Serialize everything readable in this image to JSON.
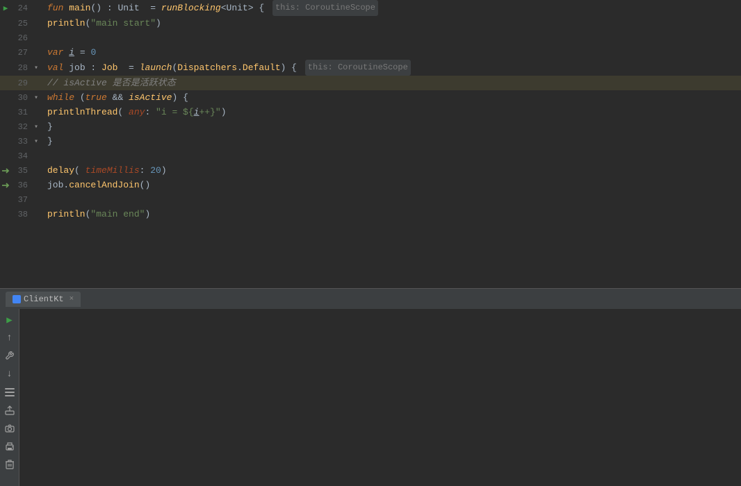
{
  "lines": [
    {
      "num": "24",
      "gutter": "play",
      "fold": "",
      "indent": "",
      "tokens": [
        {
          "t": "kw",
          "v": "fun "
        },
        {
          "t": "fn",
          "v": "main"
        },
        {
          "t": "op",
          "v": "() : "
        },
        {
          "t": "type",
          "v": "Unit"
        },
        {
          "t": "op",
          "v": "  = "
        },
        {
          "t": "fn-italic",
          "v": "runBlocking"
        },
        {
          "t": "op",
          "v": "<Unit> { "
        },
        {
          "t": "hint",
          "v": "this: CoroutineScope"
        }
      ]
    },
    {
      "num": "25",
      "gutter": "",
      "fold": "",
      "indent": "    ",
      "tokens": [
        {
          "t": "fn",
          "v": "println"
        },
        {
          "t": "op",
          "v": "("
        },
        {
          "t": "str",
          "v": "\"main start\""
        },
        {
          "t": "op",
          "v": ")"
        }
      ]
    },
    {
      "num": "26",
      "gutter": "",
      "fold": "",
      "indent": "",
      "tokens": []
    },
    {
      "num": "27",
      "gutter": "",
      "fold": "",
      "indent": "    ",
      "tokens": [
        {
          "t": "kw",
          "v": "var "
        },
        {
          "t": "var-italic",
          "v": "i"
        },
        {
          "t": "op",
          "v": " = "
        },
        {
          "t": "num",
          "v": "0"
        }
      ]
    },
    {
      "num": "28",
      "gutter": "",
      "fold": "fold",
      "indent": "    ",
      "tokens": [
        {
          "t": "kw",
          "v": "val "
        },
        {
          "t": "var-name",
          "v": "job"
        },
        {
          "t": "op",
          "v": " : "
        },
        {
          "t": "type-name",
          "v": "Job"
        },
        {
          "t": "op",
          "v": "  = "
        },
        {
          "t": "fn-italic",
          "v": "launch"
        },
        {
          "t": "op",
          "v": "("
        },
        {
          "t": "type-name",
          "v": "Dispatchers"
        },
        {
          "t": "op",
          "v": "."
        },
        {
          "t": "type-name",
          "v": "Default"
        },
        {
          "t": "op",
          "v": ") { "
        },
        {
          "t": "hint",
          "v": "this: CoroutineScope"
        }
      ]
    },
    {
      "num": "29",
      "gutter": "",
      "fold": "",
      "indent": "        ",
      "tokens": [
        {
          "t": "comment",
          "v": "// isActive 是否是活跃状态"
        }
      ],
      "highlighted": true
    },
    {
      "num": "30",
      "gutter": "",
      "fold": "fold",
      "indent": "        ",
      "tokens": [
        {
          "t": "kw",
          "v": "while "
        },
        {
          "t": "op",
          "v": "("
        },
        {
          "t": "kw",
          "v": "true"
        },
        {
          "t": "op",
          "v": " && "
        },
        {
          "t": "fn-italic",
          "v": "isActive"
        },
        {
          "t": "op",
          "v": ") {"
        }
      ]
    },
    {
      "num": "31",
      "gutter": "",
      "fold": "",
      "indent": "            ",
      "tokens": [
        {
          "t": "fn",
          "v": "printlnThread"
        },
        {
          "t": "op",
          "v": "( "
        },
        {
          "t": "param-name",
          "v": "any"
        },
        {
          "t": "op",
          "v": ": "
        },
        {
          "t": "str",
          "v": "\"i = ${"
        },
        {
          "t": "var-italic",
          "v": "i"
        },
        {
          "t": "str",
          "v": "++}\""
        },
        {
          "t": "op",
          "v": ")"
        }
      ]
    },
    {
      "num": "32",
      "gutter": "",
      "fold": "fold",
      "indent": "        ",
      "tokens": [
        {
          "t": "op",
          "v": "}"
        }
      ]
    },
    {
      "num": "33",
      "gutter": "",
      "fold": "fold",
      "indent": "    ",
      "tokens": [
        {
          "t": "op",
          "v": "}"
        }
      ]
    },
    {
      "num": "34",
      "gutter": "",
      "fold": "",
      "indent": "",
      "tokens": []
    },
    {
      "num": "35",
      "gutter": "arrow",
      "fold": "",
      "indent": "    ",
      "tokens": [
        {
          "t": "fn",
          "v": "delay"
        },
        {
          "t": "op",
          "v": "( "
        },
        {
          "t": "param-name",
          "v": "timeMillis"
        },
        {
          "t": "op",
          "v": ": "
        },
        {
          "t": "num",
          "v": "20"
        },
        {
          "t": "op",
          "v": ")"
        }
      ]
    },
    {
      "num": "36",
      "gutter": "arrow",
      "fold": "",
      "indent": "    ",
      "tokens": [
        {
          "t": "var-name",
          "v": "job"
        },
        {
          "t": "op",
          "v": "."
        },
        {
          "t": "fn",
          "v": "cancelAndJoin"
        },
        {
          "t": "op",
          "v": "()"
        }
      ]
    },
    {
      "num": "37",
      "gutter": "",
      "fold": "",
      "indent": "",
      "tokens": []
    },
    {
      "num": "38",
      "gutter": "",
      "fold": "",
      "indent": "    ",
      "tokens": [
        {
          "t": "fn",
          "v": "println"
        },
        {
          "t": "op",
          "v": "("
        },
        {
          "t": "str",
          "v": "\"main end\""
        },
        {
          "t": "op",
          "v": ")"
        }
      ]
    }
  ],
  "run_tab": {
    "label": "ClientKt",
    "close": "×"
  },
  "toolbar": {
    "run_btn": "▶",
    "up_btn": "↑",
    "wrench_btn": "🔧",
    "down_btn": "↓",
    "list_btn": "≡",
    "export_btn": "⬆",
    "camera_btn": "📷",
    "print_btn": "🖨",
    "trash_btn": "🗑"
  }
}
